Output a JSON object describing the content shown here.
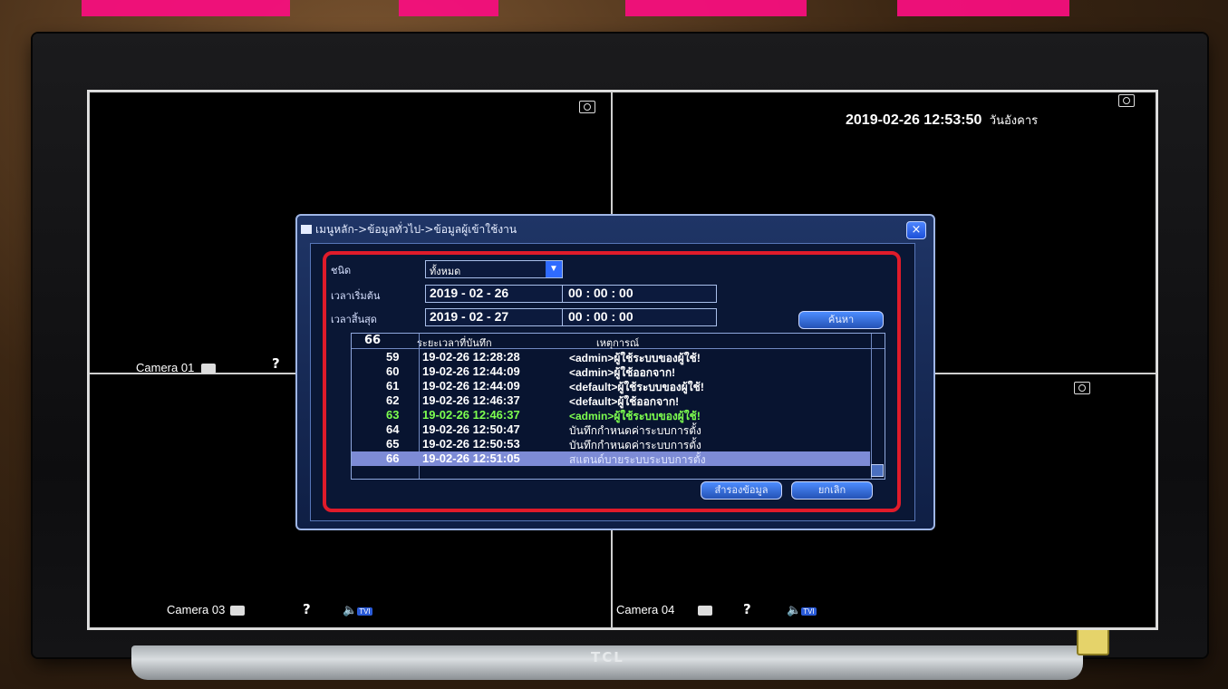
{
  "brand": "TCL",
  "clock": {
    "datetime": "2019-02-26 12:53:50",
    "day": "วันอังคาร"
  },
  "cameras": [
    {
      "label": "Camera 01",
      "help": "?"
    },
    {
      "label": "Camera 03",
      "help": "?",
      "tag": "TVI"
    },
    {
      "label": "Camera 04",
      "help": "?",
      "tag": "TVI"
    }
  ],
  "dialog": {
    "breadcrumb": "เมนูหลัก->ข้อมูลทั่วไป->ข้อมูลผู้เข้าใช้งาน",
    "close": "×",
    "type_label": "ชนิด",
    "type_value": "ทั้งหมด",
    "start_label": "เวลาเริ่มต้น",
    "end_label": "เวลาสิ้นสุด",
    "start_date": "2019  - 02 - 26",
    "start_time": "00 : 00 : 00",
    "end_date": "2019  - 02 - 27",
    "end_time": "00 : 00 : 00",
    "search_button": "ค้นหา",
    "table": {
      "count": "66",
      "col_time": "ระยะเวลาที่บันทึก",
      "col_event": "เหตุการณ์",
      "rows": [
        {
          "num": "59",
          "time": "19-02-26 12:28:28",
          "event": "<admin>ผู้ใช้ระบบของผู้ใช้!"
        },
        {
          "num": "60",
          "time": "19-02-26 12:44:09",
          "event": "<admin>ผู้ใช้ออกจาก!"
        },
        {
          "num": "61",
          "time": "19-02-26 12:44:09",
          "event": "<default>ผู้ใช้ระบบของผู้ใช้!"
        },
        {
          "num": "62",
          "time": "19-02-26 12:46:37",
          "event": "<default>ผู้ใช้ออกจาก!"
        },
        {
          "num": "63",
          "time": "19-02-26 12:46:37",
          "event": "<admin>ผู้ใช้ระบบของผู้ใช้!"
        },
        {
          "num": "64",
          "time": "19-02-26 12:50:47",
          "event": "บันทึกกำหนดค่าระบบการตั้ง"
        },
        {
          "num": "65",
          "time": "19-02-26 12:50:53",
          "event": "บันทึกกำหนดค่าระบบการตั้ง"
        },
        {
          "num": "66",
          "time": "19-02-26 12:51:05",
          "event": "สแตนด์บายระบบระบบการตั้ง"
        }
      ]
    },
    "backup_button": "สำรองข้อมูล",
    "cancel_button": "ยกเลิก"
  },
  "colors": {
    "highlight_border": "#e01b2a",
    "selected_row": "#7d8bd6",
    "green_row": "#7dff4f"
  }
}
